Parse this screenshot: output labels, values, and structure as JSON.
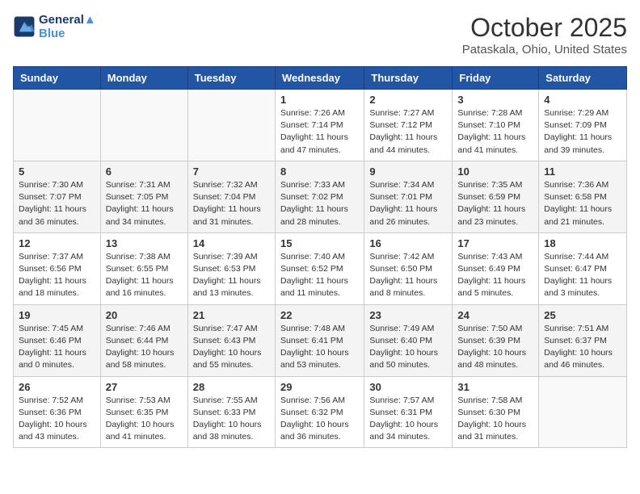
{
  "logo": {
    "line1": "General",
    "line2": "Blue"
  },
  "title": "October 2025",
  "location": "Pataskala, Ohio, United States",
  "weekdays": [
    "Sunday",
    "Monday",
    "Tuesday",
    "Wednesday",
    "Thursday",
    "Friday",
    "Saturday"
  ],
  "weeks": [
    [
      {
        "num": "",
        "info": ""
      },
      {
        "num": "",
        "info": ""
      },
      {
        "num": "",
        "info": ""
      },
      {
        "num": "1",
        "info": "Sunrise: 7:26 AM\nSunset: 7:14 PM\nDaylight: 11 hours and 47 minutes."
      },
      {
        "num": "2",
        "info": "Sunrise: 7:27 AM\nSunset: 7:12 PM\nDaylight: 11 hours and 44 minutes."
      },
      {
        "num": "3",
        "info": "Sunrise: 7:28 AM\nSunset: 7:10 PM\nDaylight: 11 hours and 41 minutes."
      },
      {
        "num": "4",
        "info": "Sunrise: 7:29 AM\nSunset: 7:09 PM\nDaylight: 11 hours and 39 minutes."
      }
    ],
    [
      {
        "num": "5",
        "info": "Sunrise: 7:30 AM\nSunset: 7:07 PM\nDaylight: 11 hours and 36 minutes."
      },
      {
        "num": "6",
        "info": "Sunrise: 7:31 AM\nSunset: 7:05 PM\nDaylight: 11 hours and 34 minutes."
      },
      {
        "num": "7",
        "info": "Sunrise: 7:32 AM\nSunset: 7:04 PM\nDaylight: 11 hours and 31 minutes."
      },
      {
        "num": "8",
        "info": "Sunrise: 7:33 AM\nSunset: 7:02 PM\nDaylight: 11 hours and 28 minutes."
      },
      {
        "num": "9",
        "info": "Sunrise: 7:34 AM\nSunset: 7:01 PM\nDaylight: 11 hours and 26 minutes."
      },
      {
        "num": "10",
        "info": "Sunrise: 7:35 AM\nSunset: 6:59 PM\nDaylight: 11 hours and 23 minutes."
      },
      {
        "num": "11",
        "info": "Sunrise: 7:36 AM\nSunset: 6:58 PM\nDaylight: 11 hours and 21 minutes."
      }
    ],
    [
      {
        "num": "12",
        "info": "Sunrise: 7:37 AM\nSunset: 6:56 PM\nDaylight: 11 hours and 18 minutes."
      },
      {
        "num": "13",
        "info": "Sunrise: 7:38 AM\nSunset: 6:55 PM\nDaylight: 11 hours and 16 minutes."
      },
      {
        "num": "14",
        "info": "Sunrise: 7:39 AM\nSunset: 6:53 PM\nDaylight: 11 hours and 13 minutes."
      },
      {
        "num": "15",
        "info": "Sunrise: 7:40 AM\nSunset: 6:52 PM\nDaylight: 11 hours and 11 minutes."
      },
      {
        "num": "16",
        "info": "Sunrise: 7:42 AM\nSunset: 6:50 PM\nDaylight: 11 hours and 8 minutes."
      },
      {
        "num": "17",
        "info": "Sunrise: 7:43 AM\nSunset: 6:49 PM\nDaylight: 11 hours and 5 minutes."
      },
      {
        "num": "18",
        "info": "Sunrise: 7:44 AM\nSunset: 6:47 PM\nDaylight: 11 hours and 3 minutes."
      }
    ],
    [
      {
        "num": "19",
        "info": "Sunrise: 7:45 AM\nSunset: 6:46 PM\nDaylight: 11 hours and 0 minutes."
      },
      {
        "num": "20",
        "info": "Sunrise: 7:46 AM\nSunset: 6:44 PM\nDaylight: 10 hours and 58 minutes."
      },
      {
        "num": "21",
        "info": "Sunrise: 7:47 AM\nSunset: 6:43 PM\nDaylight: 10 hours and 55 minutes."
      },
      {
        "num": "22",
        "info": "Sunrise: 7:48 AM\nSunset: 6:41 PM\nDaylight: 10 hours and 53 minutes."
      },
      {
        "num": "23",
        "info": "Sunrise: 7:49 AM\nSunset: 6:40 PM\nDaylight: 10 hours and 50 minutes."
      },
      {
        "num": "24",
        "info": "Sunrise: 7:50 AM\nSunset: 6:39 PM\nDaylight: 10 hours and 48 minutes."
      },
      {
        "num": "25",
        "info": "Sunrise: 7:51 AM\nSunset: 6:37 PM\nDaylight: 10 hours and 46 minutes."
      }
    ],
    [
      {
        "num": "26",
        "info": "Sunrise: 7:52 AM\nSunset: 6:36 PM\nDaylight: 10 hours and 43 minutes."
      },
      {
        "num": "27",
        "info": "Sunrise: 7:53 AM\nSunset: 6:35 PM\nDaylight: 10 hours and 41 minutes."
      },
      {
        "num": "28",
        "info": "Sunrise: 7:55 AM\nSunset: 6:33 PM\nDaylight: 10 hours and 38 minutes."
      },
      {
        "num": "29",
        "info": "Sunrise: 7:56 AM\nSunset: 6:32 PM\nDaylight: 10 hours and 36 minutes."
      },
      {
        "num": "30",
        "info": "Sunrise: 7:57 AM\nSunset: 6:31 PM\nDaylight: 10 hours and 34 minutes."
      },
      {
        "num": "31",
        "info": "Sunrise: 7:58 AM\nSunset: 6:30 PM\nDaylight: 10 hours and 31 minutes."
      },
      {
        "num": "",
        "info": ""
      }
    ]
  ]
}
